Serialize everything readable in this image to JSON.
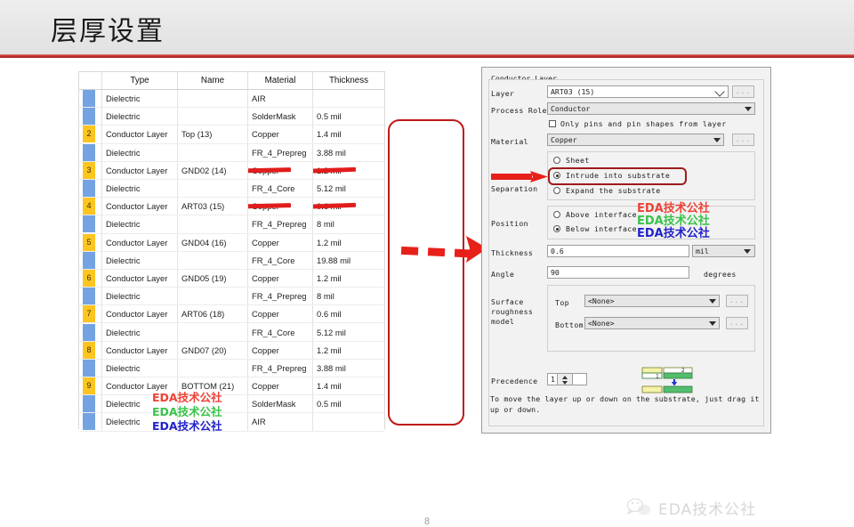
{
  "slide": {
    "title": "层厚设置",
    "page_number": "8",
    "accent_color": "#c3302e",
    "footer_brand": "EDA技术公社"
  },
  "watermark": {
    "text": "EDA技术公社",
    "colors": [
      "#ef4136",
      "#39c34a",
      "#2222cc"
    ]
  },
  "layer_table": {
    "headers": [
      "Type",
      "Name",
      "Material",
      "Thickness"
    ],
    "swatch_colors": {
      "dielectric": "#74a3e2",
      "conductor": "#fcc520"
    },
    "highlight_color": "#c01818",
    "rows": [
      {
        "num": "",
        "kind": "dielectric",
        "type": "Dielectric",
        "name": "",
        "material": "AIR",
        "thickness": ""
      },
      {
        "num": "",
        "kind": "dielectric",
        "type": "Dielectric",
        "name": "",
        "material": "SolderMask",
        "thickness": "0.5 mil"
      },
      {
        "num": "2",
        "kind": "conductor",
        "type": "Conductor Layer",
        "name": "Top (13)",
        "material": "Copper",
        "thickness": "1.4 mil"
      },
      {
        "num": "",
        "kind": "dielectric",
        "type": "Dielectric",
        "name": "",
        "material": "FR_4_Prepreg",
        "thickness": "3.88 mil"
      },
      {
        "num": "3",
        "kind": "conductor",
        "type": "Conductor Layer",
        "name": "GND02 (14)",
        "material": "Copper",
        "thickness": "1.2 mil",
        "struck": true
      },
      {
        "num": "",
        "kind": "dielectric",
        "type": "Dielectric",
        "name": "",
        "material": "FR_4_Core",
        "thickness": "5.12 mil"
      },
      {
        "num": "4",
        "kind": "conductor",
        "type": "Conductor Layer",
        "name": "ART03 (15)",
        "material": "Copper",
        "thickness": "0.6 mil",
        "struck": true
      },
      {
        "num": "",
        "kind": "dielectric",
        "type": "Dielectric",
        "name": "",
        "material": "FR_4_Prepreg",
        "thickness": "8 mil"
      },
      {
        "num": "5",
        "kind": "conductor",
        "type": "Conductor Layer",
        "name": "GND04 (16)",
        "material": "Copper",
        "thickness": "1.2 mil"
      },
      {
        "num": "",
        "kind": "dielectric",
        "type": "Dielectric",
        "name": "",
        "material": "FR_4_Core",
        "thickness": "19.88 mil"
      },
      {
        "num": "6",
        "kind": "conductor",
        "type": "Conductor Layer",
        "name": "GND05 (19)",
        "material": "Copper",
        "thickness": "1.2 mil"
      },
      {
        "num": "",
        "kind": "dielectric",
        "type": "Dielectric",
        "name": "",
        "material": "FR_4_Prepreg",
        "thickness": "8 mil"
      },
      {
        "num": "7",
        "kind": "conductor",
        "type": "Conductor Layer",
        "name": "ART06 (18)",
        "material": "Copper",
        "thickness": "0.6 mil"
      },
      {
        "num": "",
        "kind": "dielectric",
        "type": "Dielectric",
        "name": "",
        "material": "FR_4_Core",
        "thickness": "5.12 mil"
      },
      {
        "num": "8",
        "kind": "conductor",
        "type": "Conductor Layer",
        "name": "GND07 (20)",
        "material": "Copper",
        "thickness": "1.2 mil"
      },
      {
        "num": "",
        "kind": "dielectric",
        "type": "Dielectric",
        "name": "",
        "material": "FR_4_Prepreg",
        "thickness": "3.88 mil"
      },
      {
        "num": "9",
        "kind": "conductor",
        "type": "Conductor Layer",
        "name": "BOTTOM (21)",
        "material": "Copper",
        "thickness": "1.4 mil"
      },
      {
        "num": "",
        "kind": "dielectric",
        "type": "Dielectric",
        "name": "",
        "material": "SolderMask",
        "thickness": "0.5 mil"
      },
      {
        "num": "",
        "kind": "dielectric",
        "type": "Dielectric",
        "name": "",
        "material": "AIR",
        "thickness": ""
      }
    ]
  },
  "dialog": {
    "group_title": "Conductor Layer",
    "layer": {
      "label": "Layer",
      "value": "ART03 (15)",
      "browse": "..."
    },
    "process_role": {
      "label": "Process Role",
      "value": "Conductor"
    },
    "only_pins": {
      "label": "Only pins and pin shapes from layer",
      "checked": false
    },
    "material": {
      "label": "Material",
      "value": "Copper",
      "browse": "..."
    },
    "separation": {
      "label": "Separation",
      "options": [
        "Sheet",
        "Intrude into substrate",
        "Expand the substrate"
      ],
      "selected": "Intrude into substrate",
      "highlight_color": "#9e1b1b"
    },
    "position": {
      "label": "Position",
      "options": [
        "Above interface",
        "Below interface"
      ],
      "selected": "Below interface"
    },
    "thickness": {
      "label": "Thickness",
      "value": "0.6",
      "unit": "mil"
    },
    "angle": {
      "label": "Angle",
      "value": "90",
      "unit": "degrees"
    },
    "surface_roughness": {
      "label": "Surface roughness model",
      "top_label": "Top",
      "top_value": "<None>",
      "top_browse": "...",
      "bottom_label": "Bottom",
      "bottom_value": "<None>",
      "bottom_browse": "..."
    },
    "precedence": {
      "label": "Precedence",
      "value": "1"
    },
    "hint": "To move the layer up or down on the substrate, just drag it up or down.",
    "stack_labels": [
      "1",
      "2"
    ]
  }
}
